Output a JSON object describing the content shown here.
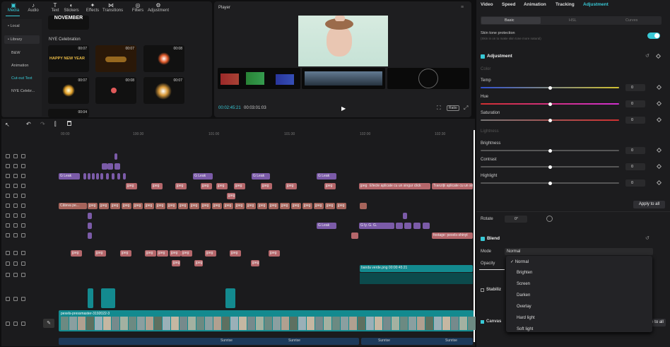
{
  "media_tabs": [
    {
      "label": "Media",
      "icon": "media-icon"
    },
    {
      "label": "Audio",
      "icon": "audio-icon"
    },
    {
      "label": "Text",
      "icon": "text-icon"
    },
    {
      "label": "Stickers",
      "icon": "sticker-icon"
    },
    {
      "label": "Effects",
      "icon": "effects-icon"
    },
    {
      "label": "Transitions",
      "icon": "transitions-icon"
    },
    {
      "label": "Filters",
      "icon": "filters-icon"
    },
    {
      "label": "Adjustment",
      "icon": "adjustment-icon"
    }
  ],
  "library": {
    "local": "• Local",
    "library": "• Library",
    "items": [
      "B&W",
      "Animation",
      "Cut-out Text",
      "NYE Celebr..."
    ]
  },
  "stickers": {
    "section_title": "NYE Celebration",
    "top_thumb_text": "NOVEMBER",
    "durations": [
      "00:07",
      "00:07",
      "00:08",
      "00:07",
      "00:08",
      "00:07",
      "00:04"
    ],
    "happy_new_year": "HAPPY NEW YEAR"
  },
  "player": {
    "title": "Player",
    "time_current": "00:02:45:21",
    "time_total": "00:03:01:03",
    "ratio_label": "Ratio"
  },
  "toolbar": {
    "undo": "↶",
    "redo": "↷",
    "split": "⫿",
    "delete": "🗑"
  },
  "ruler": [
    "00:00",
    "100:30",
    "101:00",
    "101:30",
    "102:00",
    "102:30"
  ],
  "text_clip": "jpeg",
  "leak_clip": "G Leak",
  "track_clips": {
    "effects_row": [
      "G Leak",
      "G Leak",
      "G Leak",
      "G Leak"
    ],
    "text_row2": [
      "jpeg",
      "jpeg",
      "jpeg",
      "jpeg",
      "jpeg",
      "jpeg",
      "jpeg",
      "jpeg",
      "jpeg",
      "jpeg",
      "jpeg",
      "jpe",
      "Efecte aplicate cu un singur click",
      "Tranziții aplicate cu un singur"
    ],
    "text_row4": "Căteva pe...",
    "sticker_row": [
      "G",
      "G Leak",
      "G ly. G. G.",
      "G",
      "G"
    ],
    "footage": "footage: pexels-shinyt",
    "cam_clip": "banda verde.png  00:00:45:21",
    "main_label": "pexels-pressmaster-3192022-3"
  },
  "sunrise_label": "Sunrise",
  "right_tabs": [
    "Video",
    "Speed",
    "Animation",
    "Tracking",
    "Adjustment"
  ],
  "sub_tabs": [
    "Basic",
    "HSL",
    "Curves"
  ],
  "skin_tone": {
    "title": "Skin tone protection",
    "desc": "(Skin in on to make skin tone more natural)"
  },
  "adjustment": {
    "title": "Adjustment",
    "color_header": "Color",
    "lightness_header": "Lightness",
    "sliders": [
      {
        "label": "Temp",
        "value": "0"
      },
      {
        "label": "Hue",
        "value": "0"
      },
      {
        "label": "Saturation",
        "value": "0"
      },
      {
        "label": "Brightness",
        "value": "0"
      },
      {
        "label": "Contrast",
        "value": "0"
      },
      {
        "label": "Highlight",
        "value": "0"
      },
      {
        "label": "Shadow",
        "value": "0"
      }
    ]
  },
  "apply_all": "Apply to all",
  "rotate": {
    "label": "Rotate",
    "value": "0°"
  },
  "blend": {
    "title": "Blend",
    "mode_label": "Mode",
    "mode_value": "Normal",
    "opacity_label": "Opacity",
    "options": [
      "Normal",
      "Brighten",
      "Screen",
      "Darken",
      "Overlay",
      "Hard light",
      "Soft light"
    ]
  },
  "stabilize": "Stabiliz",
  "canvas": "Canvas",
  "colors": {
    "accent": "#38c9d6",
    "clip_pink": "#b5676b",
    "clip_purple": "#7b5ba8",
    "clip_teal": "#138a8f"
  }
}
